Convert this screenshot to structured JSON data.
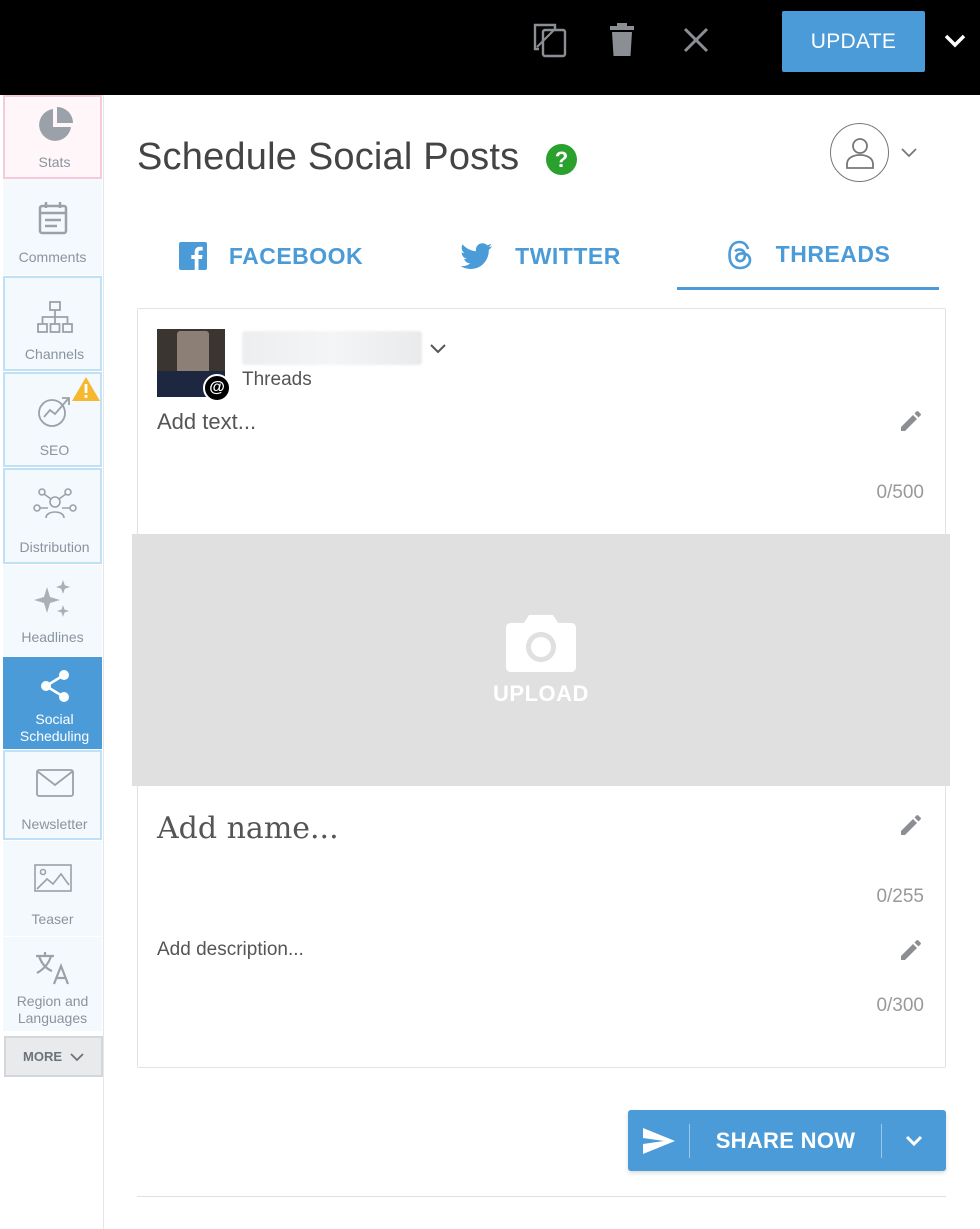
{
  "topbar": {
    "duplicate_icon": "duplicate-icon",
    "delete_icon": "trash-icon",
    "close_icon": "close-icon",
    "update_label": "UPDATE",
    "update_menu_icon": "chevron-down-icon"
  },
  "sidebar": {
    "items": [
      {
        "label": "Stats",
        "icon": "pie-chart-icon"
      },
      {
        "label": "Comments",
        "icon": "calendar-icon"
      },
      {
        "label": "Channels",
        "icon": "sitemap-icon"
      },
      {
        "label": "SEO",
        "icon": "seo-target-icon",
        "badge": "warning-icon"
      },
      {
        "label": "Distribution",
        "icon": "network-icon"
      },
      {
        "label": "Headlines",
        "icon": "sparkle-icon"
      },
      {
        "label": "Social\nScheduling",
        "label_line1": "Social",
        "label_line2": "Scheduling",
        "icon": "share-icon"
      },
      {
        "label": "Newsletter",
        "icon": "envelope-icon"
      },
      {
        "label": "Teaser",
        "icon": "image-icon"
      },
      {
        "label": "Region and\nLanguages",
        "label_line1": "Region and",
        "label_line2": "Languages",
        "icon": "translate-icon"
      }
    ],
    "more_label": "MORE"
  },
  "header": {
    "title": "Schedule Social Posts",
    "help": "?",
    "user_icon": "user-icon"
  },
  "tabs": [
    {
      "label": "FACEBOOK",
      "icon": "facebook-icon",
      "active": false
    },
    {
      "label": "TWITTER",
      "icon": "twitter-icon",
      "active": false
    },
    {
      "label": "THREADS",
      "icon": "threads-icon",
      "active": true
    }
  ],
  "post": {
    "account_platform": "Threads",
    "text_placeholder": "Add text...",
    "text_counter": "0/500",
    "upload_label": "UPLOAD",
    "name_placeholder": "Add name...",
    "name_counter": "0/255",
    "description_placeholder": "Add description...",
    "description_counter": "0/300"
  },
  "share": {
    "label": "SHARE NOW"
  },
  "colors": {
    "accent": "#4a9bd8",
    "help_green": "#2aa12d",
    "warning": "#f5b82e",
    "topbar": "#000000"
  }
}
